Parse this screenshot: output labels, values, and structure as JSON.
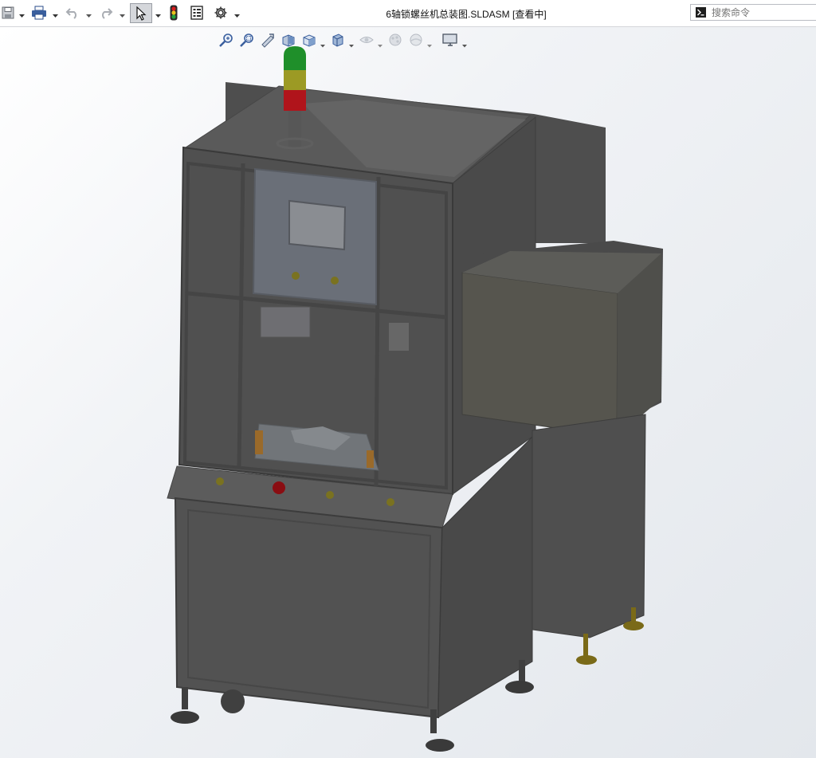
{
  "window": {
    "title": "6轴锁螺丝机总装图.SLDASM [查看中]"
  },
  "command_search": {
    "placeholder": "搜索命令",
    "icon": "terminal-prompt-icon"
  },
  "toolbar": {
    "icons": [
      "save-icon",
      "print-icon",
      "undo-icon",
      "redo-icon",
      "select-arrow-icon",
      "traffic-light-icon",
      "file-properties-icon",
      "gear-icon"
    ]
  },
  "view_toolbar": {
    "icons": [
      "zoom-to-fit-icon",
      "zoom-to-area-icon",
      "previous-view-icon",
      "section-view-icon",
      "view-orientation-icon",
      "display-style-icon",
      "hide-show-items-icon",
      "edit-appearance-icon",
      "apply-scene-icon",
      "view-settings-icon"
    ]
  },
  "colors": {
    "machine_body": "#555555",
    "signal_green": "#1f8f2a",
    "signal_yellow": "#9c9a24",
    "signal_red": "#b0141b",
    "panel_blue_gray": "#6a6f78",
    "brass": "#7a6a18"
  }
}
